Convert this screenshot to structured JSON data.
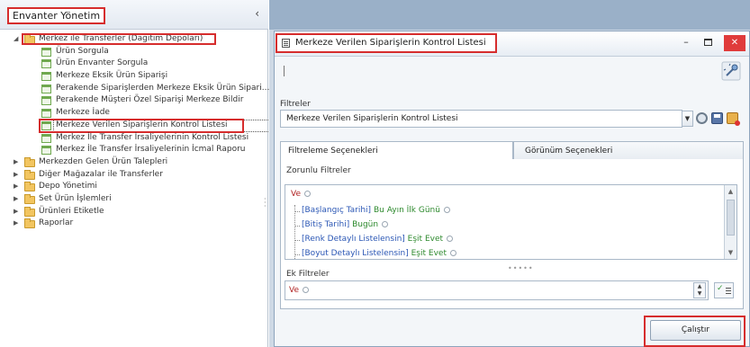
{
  "nav": {
    "title": "Envanter Yönetim",
    "collapse_icon": "chevron-left-icon",
    "tree": [
      {
        "label": "Merkez ile Transferler (Dağıtım Depoları)",
        "expanded": true,
        "children": [
          "Ürün Sorgula",
          "Ürün Envanter Sorgula",
          "Merkeze Eksik Ürün Siparişi",
          "Perakende Siparişlerden Merkeze Eksik Ürün Sipari...",
          "Perakende Müşteri Özel Siparişi Merkeze Bildir",
          "Merkeze İade",
          "Merkeze Verilen Siparişlerin Kontrol Listesi",
          "Merkez İle Transfer İrsaliyelerinin Kontrol Listesi",
          "Merkez İle Transfer İrsaliyelerinin İcmal Raporu"
        ]
      },
      {
        "label": "Merkezden Gelen Ürün Talepleri"
      },
      {
        "label": "Diğer Mağazalar ile Transferler"
      },
      {
        "label": "Depo Yönetimi"
      },
      {
        "label": "Set Ürün İşlemleri"
      },
      {
        "label": "Ürünleri Etiketle"
      },
      {
        "label": "Raporlar"
      }
    ]
  },
  "dialog": {
    "title": "Merkeze Verilen Siparişlerin Kontrol Listesi",
    "minimize": "–",
    "close": "✕",
    "filters_label": "Filtreler",
    "filter_value": "Merkeze Verilen Siparişlerin Kontrol Listesi",
    "tabs": [
      "Filtreleme Seçenekleri",
      "Görünüm Seçenekleri"
    ],
    "required_label": "Zorunlu Filtreler",
    "root_op": "Ve",
    "conditions": [
      {
        "field": "[Başlangıç Tarihi]",
        "op": "Bu Ayın İlk Günü",
        "value": ""
      },
      {
        "field": "[Bitiş Tarihi]",
        "op": "Bugün",
        "value": ""
      },
      {
        "field": "[Renk Detaylı Listelensin]",
        "op": "Eşit",
        "value": "Evet"
      },
      {
        "field": "[Boyut Detaylı Listelensin]",
        "op": "Eşit",
        "value": "Evet"
      }
    ],
    "extra_label": "Ek Filtreler",
    "extra_op": "Ve",
    "run_button": "Çalıştır"
  },
  "colors": {
    "highlight": "#d62d2d",
    "field": "#2b57b5",
    "operator": "#2e8a2e",
    "logical": "#b02323"
  }
}
